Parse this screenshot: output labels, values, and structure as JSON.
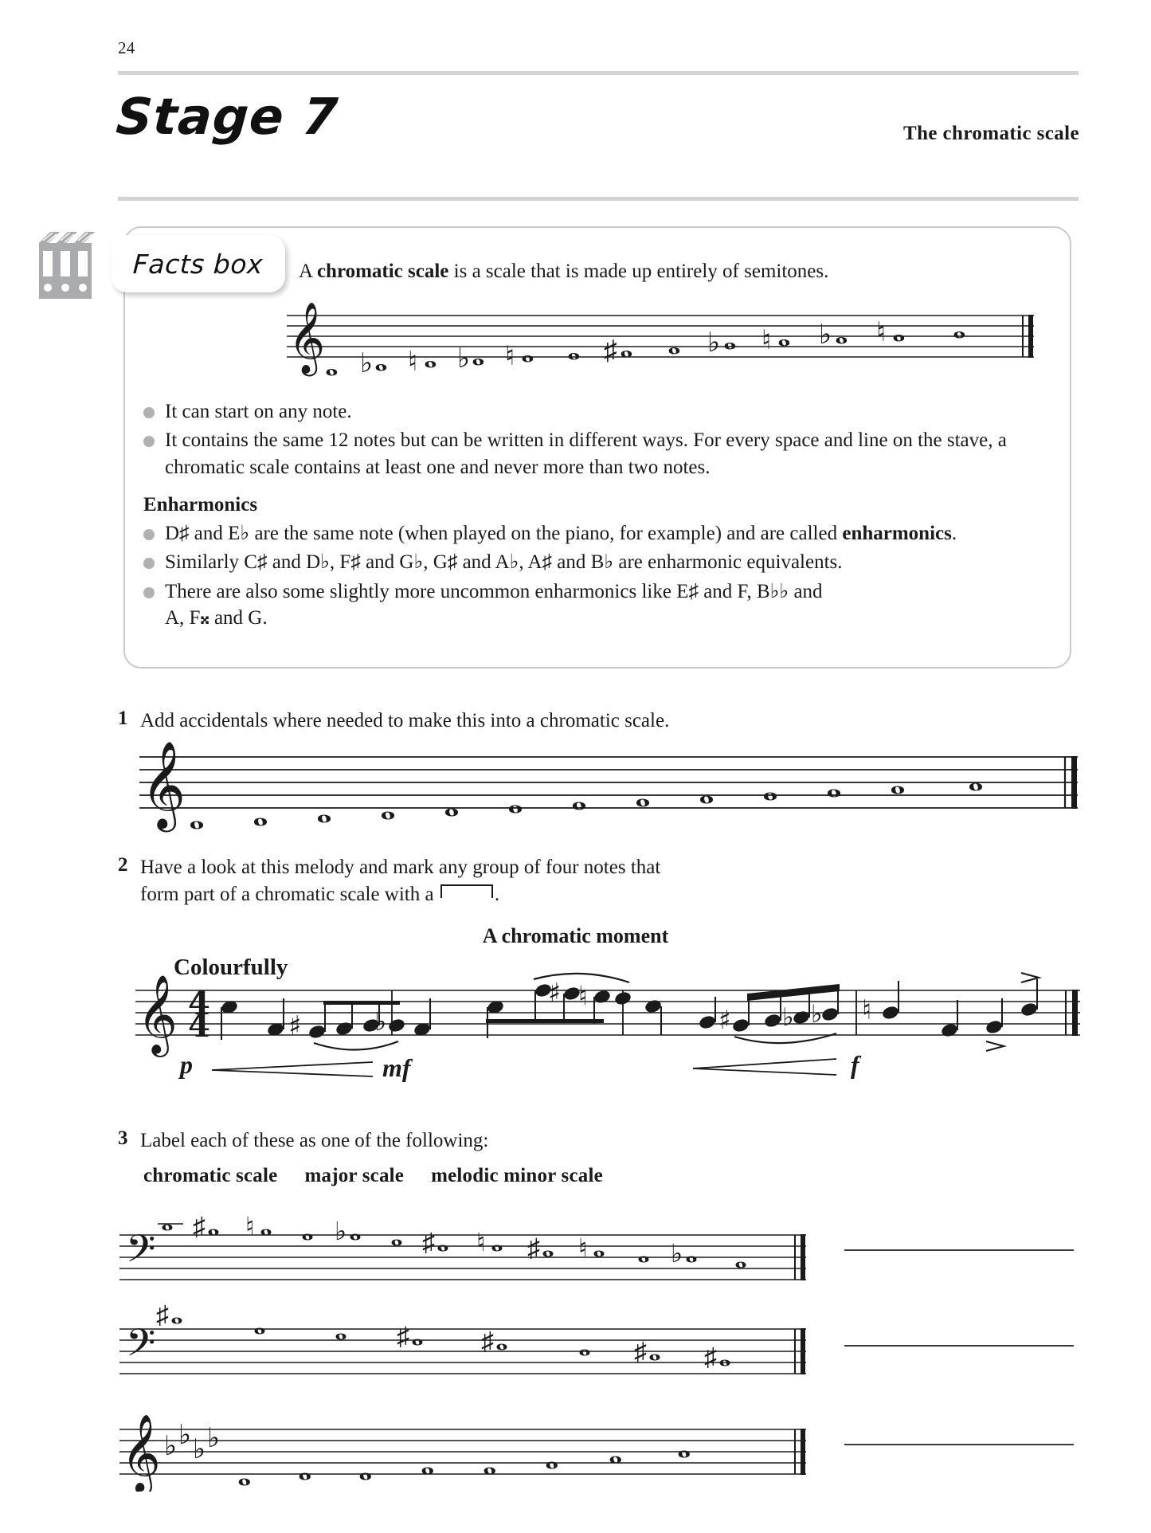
{
  "page": {
    "number": "24",
    "stage_title": "Stage 7",
    "header_right": "The chromatic scale"
  },
  "facts_box": {
    "icon": "binders-icon",
    "pill_label": "Facts box",
    "intro_prefix": "A ",
    "intro_bold": "chromatic scale",
    "intro_suffix": " is a scale that is made up entirely of semitones.",
    "bullets": [
      "It can start on any note.",
      "It contains the same 12 notes but can be written in different ways. For every space and line on the stave, a chromatic scale contains at least one and never more than two notes."
    ],
    "enharmonics_heading": "Enharmonics",
    "enharmonics_bullets": [
      {
        "pre": "D♯ and E♭ are the same note (when played on the piano, for example) and are called ",
        "bold": "enharmonics",
        "post": "."
      },
      {
        "pre": "Similarly C♯ and D♭, F♯ and G♭, G♯ and A♭, A♯ and B♭ are enharmonic equivalents.",
        "bold": "",
        "post": ""
      },
      {
        "pre": "There are also some slightly more uncommon enharmonics like E♯ and F, B♭♭ and A, F𝄪 and G.",
        "bold": "",
        "post": ""
      }
    ],
    "stave": {
      "clef": "treble",
      "notes": [
        {
          "accidental": "",
          "step": 0
        },
        {
          "accidental": "♭",
          "step": 1
        },
        {
          "accidental": "♮",
          "step": 1
        },
        {
          "accidental": "♭",
          "step": 2
        },
        {
          "accidental": "♮",
          "step": 2
        },
        {
          "accidental": "",
          "step": 3
        },
        {
          "accidental": "♯",
          "step": 3
        },
        {
          "accidental": "",
          "step": 4
        },
        {
          "accidental": "♭",
          "step": 5
        },
        {
          "accidental": "♮",
          "step": 5
        },
        {
          "accidental": "♭",
          "step": 6
        },
        {
          "accidental": "♮",
          "step": 6
        },
        {
          "accidental": "",
          "step": 7
        }
      ]
    }
  },
  "questions": [
    {
      "number": "1",
      "text": "Add accidentals where needed to make this into a chromatic scale.",
      "stave": {
        "clef": "treble",
        "notes": [
          {
            "accidental": "",
            "step": 0
          },
          {
            "accidental": "",
            "step": 1
          },
          {
            "accidental": "",
            "step": 2
          },
          {
            "accidental": "",
            "step": 3
          },
          {
            "accidental": "",
            "step": 4
          },
          {
            "accidental": "",
            "step": 5
          },
          {
            "accidental": "",
            "step": 6
          },
          {
            "accidental": "",
            "step": 7
          },
          {
            "accidental": "",
            "step": 8
          },
          {
            "accidental": "",
            "step": 9
          },
          {
            "accidental": "",
            "step": 10
          },
          {
            "accidental": "",
            "step": 11
          },
          {
            "accidental": "",
            "step": 12
          }
        ]
      }
    },
    {
      "number": "2",
      "line1": "Have a look at this melody and mark any group of four notes that",
      "line2_pre": "form part of a chromatic scale with a ",
      "line2_post": ".",
      "melody_title": "A chromatic moment",
      "tempo": "Colourfully",
      "time_signature": {
        "top": "4",
        "bottom": "4"
      },
      "dynamics": [
        "p",
        "mf",
        "f"
      ]
    },
    {
      "number": "3",
      "text": "Label each of these as one of the following:",
      "options": [
        "chromatic scale",
        "major scale",
        "melodic minor scale"
      ],
      "staves": [
        {
          "clef": "bass",
          "key_signature": []
        },
        {
          "clef": "bass",
          "key_signature": []
        },
        {
          "clef": "treble",
          "key_signature": [
            "♭",
            "♭",
            "♭",
            "♭"
          ]
        }
      ],
      "answer_lines": [
        "",
        "",
        ""
      ]
    }
  ],
  "colors": {
    "rule": "#d2d3d5",
    "bullet": "#b0b1b3",
    "box_border": "#c9cacc",
    "icon_gray": "#a9abae",
    "text": "#1a1a1a"
  }
}
